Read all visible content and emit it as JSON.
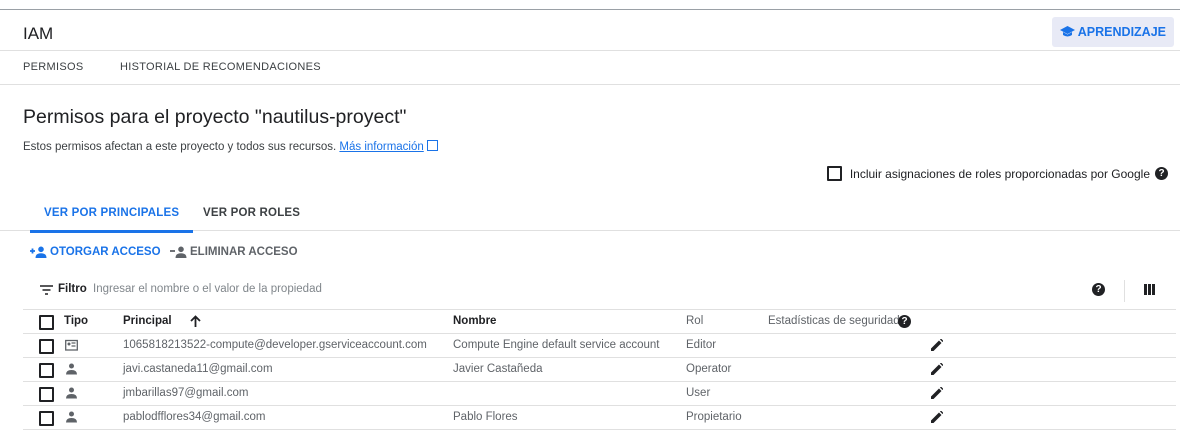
{
  "header": {
    "title": "IAM",
    "learn_label": "APRENDIZAJE"
  },
  "top_tabs": [
    "PERMISOS",
    "HISTORIAL DE RECOMENDACIONES"
  ],
  "page": {
    "title": "Permisos para el proyecto \"nautilus-proyect\"",
    "description": "Estos permisos afectan a este proyecto y todos sus recursos.",
    "more_info_link": "Más información",
    "include_google_roles_label": "Incluir asignaciones de roles proporcionadas por Google"
  },
  "view_tabs": {
    "principals": "VER POR PRINCIPALES",
    "roles": "VER POR ROLES"
  },
  "actions": {
    "grant": "OTORGAR ACCESO",
    "remove": "ELIMINAR ACCESO"
  },
  "filter": {
    "label": "Filtro",
    "placeholder": "Ingresar el nombre o el valor de la propiedad"
  },
  "table": {
    "columns": {
      "type": "Tipo",
      "principal": "Principal",
      "name": "Nombre",
      "role": "Rol",
      "security": "Estadísticas de seguridad"
    },
    "rows": [
      {
        "type_icon": "service-account-icon",
        "principal": "1065818213522-compute@developer.gserviceaccount.com",
        "name": "Compute Engine default service account",
        "role": "Editor"
      },
      {
        "type_icon": "person-icon",
        "principal": "javi.castaneda11@gmail.com",
        "name": "Javier Castañeda",
        "role": "Operator"
      },
      {
        "type_icon": "person-icon",
        "principal": "jmbarillas97@gmail.com",
        "name": "",
        "role": "User"
      },
      {
        "type_icon": "person-icon",
        "principal": "pablodfflores34@gmail.com",
        "name": "Pablo Flores",
        "role": "Propietario"
      }
    ]
  },
  "colors": {
    "accent": "#1a73e8",
    "text": "#202124",
    "muted": "#5f6368",
    "divider": "#e0e0e0"
  }
}
